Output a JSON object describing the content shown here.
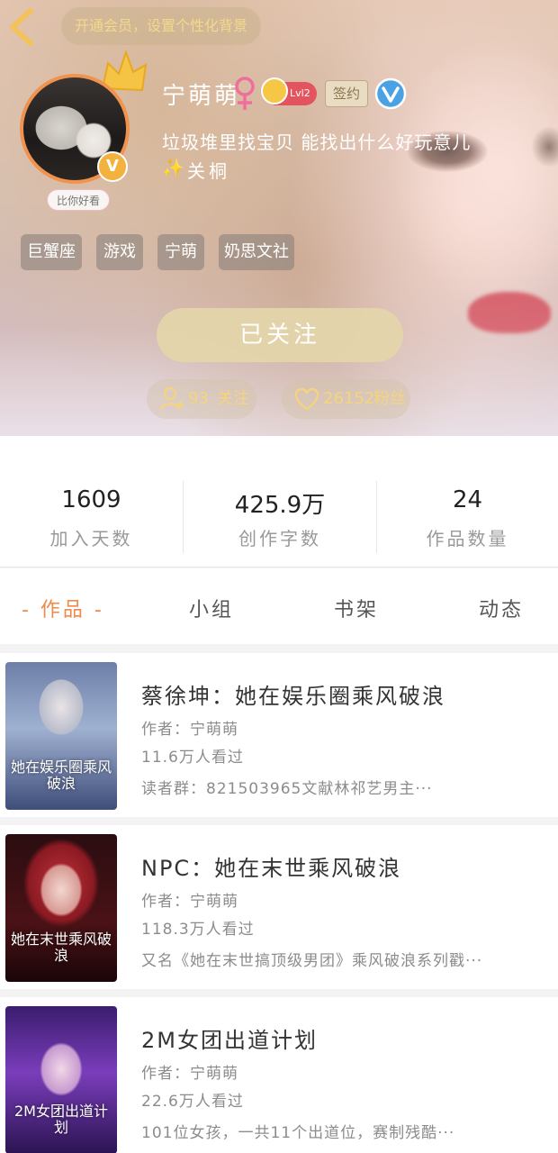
{
  "header": {
    "vip_prompt": "开通会员，设置个性化背景",
    "avatar_caption": "比你好看",
    "avatar_badge": "V",
    "username": "宁萌萌",
    "level": "Lvl2",
    "sign_label": "签约",
    "bio_line1": "垃圾堆里找宝贝 能找出什么好玩意儿",
    "bio_sparkle": "✨",
    "bio_line2": "关桐",
    "tags": [
      "巨蟹座",
      "游戏",
      "宁萌",
      "奶思文社"
    ],
    "follow_button": "已关注",
    "following_count": "93",
    "following_label": "关注",
    "fans_count": "26152",
    "fans_label": "粉丝",
    "accent_color": "#f08a4b"
  },
  "stats": [
    {
      "value": "1609",
      "label": "加入天数"
    },
    {
      "value": "425.9万",
      "label": "创作字数"
    },
    {
      "value": "24",
      "label": "作品数量"
    }
  ],
  "tabs": [
    {
      "label": "- 作品 -",
      "active": true
    },
    {
      "label": "小组",
      "active": false
    },
    {
      "label": "书架",
      "active": false
    },
    {
      "label": "动态",
      "active": false
    }
  ],
  "works": [
    {
      "title": "蔡徐坤：她在娱乐圈乘风破浪",
      "author": "作者：宁萌萌",
      "views": "11.6万人看过",
      "desc": "读者群：821503965文献林祁艺男主···",
      "cover_text": "她在娱乐圈乘风破浪"
    },
    {
      "title": "NPC：她在末世乘风破浪",
      "author": "作者：宁萌萌",
      "views": "118.3万人看过",
      "desc": "又名《她在末世搞顶级男团》乘风破浪系列戳···",
      "cover_text": "她在末世乘风破浪"
    },
    {
      "title": "2M女团出道计划",
      "author": "作者：宁萌萌",
      "views": "22.6万人看过",
      "desc": "101位女孩，一共11个出道位，赛制残酷···",
      "cover_text": "2M女团出道计划"
    }
  ]
}
